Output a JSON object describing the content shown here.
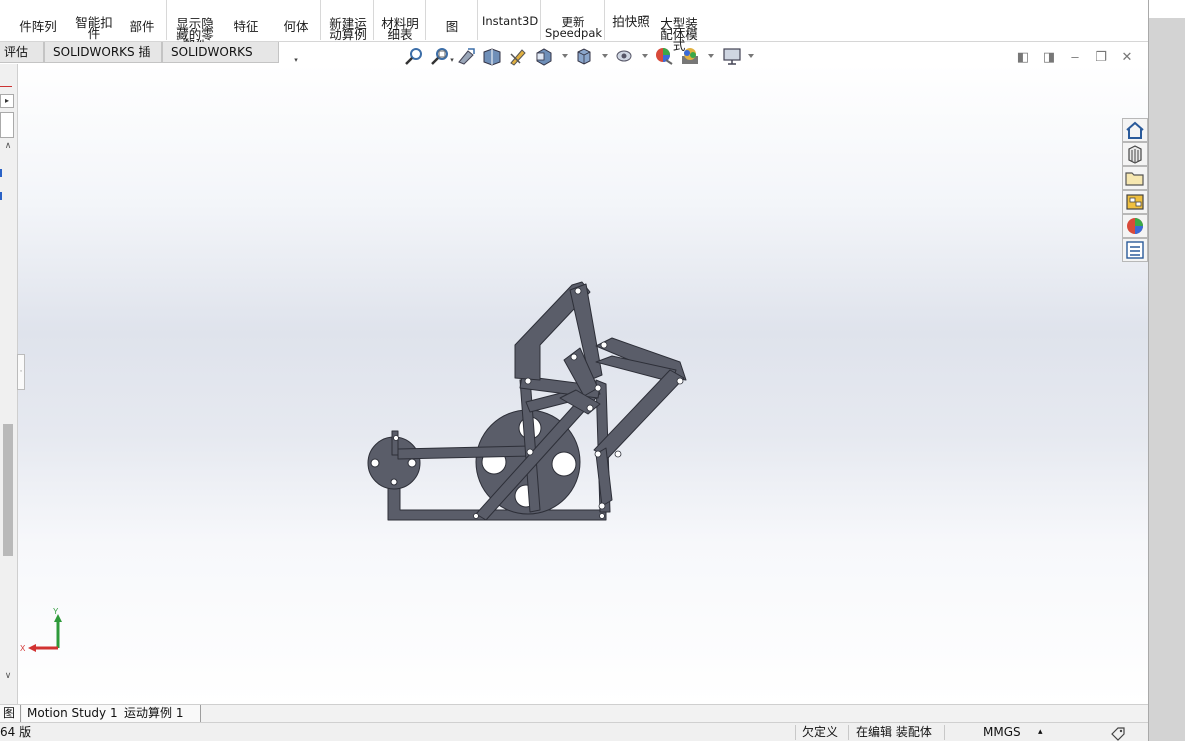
{
  "ribbon": {
    "buttons": [
      {
        "id": "pattern",
        "label": "件阵列"
      },
      {
        "id": "smart",
        "label": "智能扣\n件"
      },
      {
        "id": "assembly",
        "label": "部件"
      },
      {
        "id": "show_hidden",
        "label": "显示隐\n藏的零\n部件"
      },
      {
        "id": "ref_geom",
        "label": "特征"
      },
      {
        "id": "geometry",
        "label": "何体"
      },
      {
        "id": "new_motion",
        "label": "新建运\n动算例"
      },
      {
        "id": "bom",
        "label": "材料明\n细表"
      },
      {
        "id": "exploded",
        "label": "图"
      },
      {
        "id": "instant3d",
        "label": "Instant3D"
      },
      {
        "id": "speedpak",
        "label": "更新\nSpeedpak"
      },
      {
        "id": "snapshot",
        "label": "拍快照"
      },
      {
        "id": "large_asm",
        "label": "大型装\n配体模\n式"
      }
    ]
  },
  "command_tabs": [
    "评估",
    "SOLIDWORKS 插件",
    "SOLIDWORKS MBD"
  ],
  "hud_icons": [
    "zoom-to-fit-icon",
    "zoom-to-area-icon",
    "previous-view-icon",
    "section-view-icon",
    "dynamic-annotation-icon",
    "view-orientation-icon",
    "display-style-icon",
    "hide-show-icon",
    "edit-appearance-icon",
    "apply-scene-icon",
    "view-settings-icon"
  ],
  "task_pane_icons": [
    "home-icon",
    "design-library-icon",
    "file-explorer-icon",
    "view-palette-icon",
    "appearances-icon",
    "custom-properties-icon"
  ],
  "triad": {
    "x_label": "X",
    "y_label": "Y"
  },
  "bottom_tabs": [
    "图",
    "Motion Study 1",
    "运动算例 1"
  ],
  "status": {
    "left": "64 版",
    "underdefined": "欠定义",
    "editing": "在编辑 装配体",
    "units": "MMGS",
    "units_caret": "▴"
  },
  "colors": {
    "part": "#5a5d69",
    "part_edge": "#2d2f38",
    "axis_x": "#d23232",
    "axis_y": "#2e9a3a"
  }
}
